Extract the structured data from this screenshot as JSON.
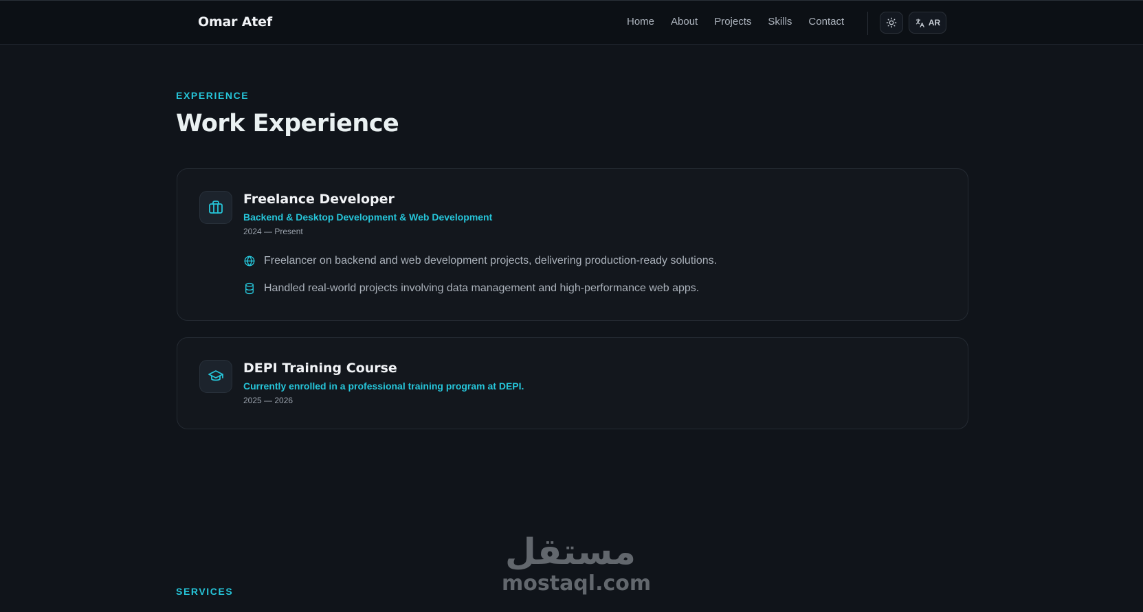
{
  "nav": {
    "brand": "Omar Atef",
    "links": [
      "Home",
      "About",
      "Projects",
      "Skills",
      "Contact"
    ],
    "lang_label": "AR"
  },
  "experience": {
    "section_label": "EXPERIENCE",
    "title": "Work Experience",
    "items": [
      {
        "title": "Freelance Developer",
        "subtitle": "Backend & Desktop Development & Web Development",
        "dates": "2024 — Present",
        "icon": "briefcase-icon",
        "bullets": [
          {
            "icon": "globe-icon",
            "text": "Freelancer on backend and web development projects, delivering production-ready solutions."
          },
          {
            "icon": "database-icon",
            "text": "Handled real-world projects involving data management and high-performance web apps."
          }
        ]
      },
      {
        "title": "DEPI Training Course",
        "subtitle": "Currently enrolled in a professional training program at DEPI.",
        "dates": "2025 — 2026",
        "icon": "graduation-cap-icon"
      }
    ]
  },
  "services": {
    "section_label": "SERVICES"
  },
  "watermark": {
    "arabic": "مستقل",
    "latin": "mostaql.com"
  },
  "colors": {
    "accent": "#26c6da",
    "background": "#10141a",
    "card": "#13171d"
  }
}
